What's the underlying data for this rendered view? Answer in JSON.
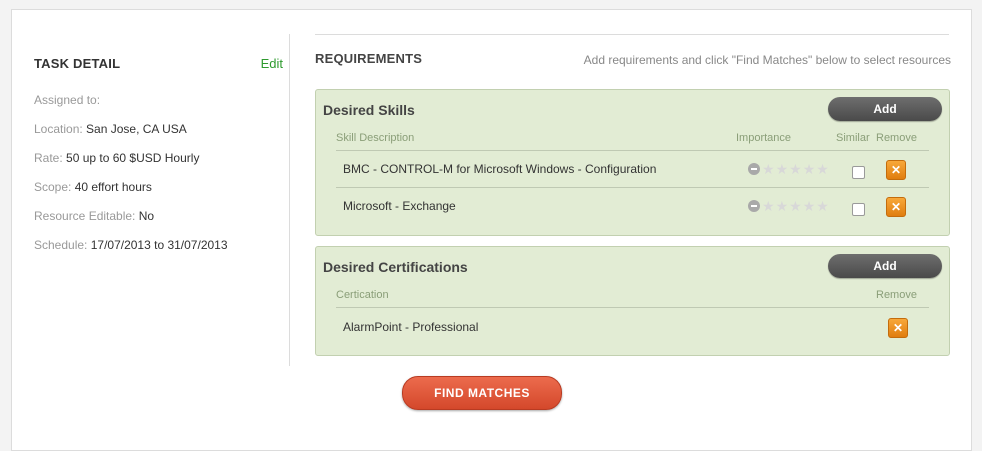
{
  "task_detail": {
    "title": "TASK DETAIL",
    "edit_label": "Edit",
    "assigned_label": "Assigned to:",
    "assigned_value": "",
    "location_label": "Location:",
    "location_value": "San Jose, CA USA",
    "rate_label": "Rate:",
    "rate_value": "50 up to 60 $USD Hourly",
    "scope_label": "Scope:",
    "scope_value": "40 effort hours",
    "editable_label": "Resource Editable:",
    "editable_value": "No",
    "schedule_label": "Schedule:",
    "schedule_value": "17/07/2013 to 31/07/2013"
  },
  "requirements": {
    "title": "REQUIREMENTS",
    "hint": "Add requirements and click \"Find Matches\" below to select resources"
  },
  "skills": {
    "title": "Desired Skills",
    "add_label": "Add",
    "col_description": "Skill Description",
    "col_importance": "Importance",
    "col_similar": "Similar",
    "col_remove": "Remove",
    "rows": [
      {
        "description": "BMC - CONTROL-M for Microsoft Windows - Configuration",
        "importance": 0,
        "similar": false
      },
      {
        "description": "Microsoft - Exchange",
        "importance": 0,
        "similar": false
      }
    ]
  },
  "certifications": {
    "title": "Desired Certifications",
    "add_label": "Add",
    "col_certification": "Certication",
    "col_remove": "Remove",
    "rows": [
      {
        "name": "AlarmPoint - Professional"
      }
    ]
  },
  "find_matches_label": "FIND MATCHES",
  "colors": {
    "accent_green": "#2e9a2e",
    "box_bg": "#e2ecd4",
    "remove_orange": "#f08f1f",
    "find_red": "#e05a3c"
  },
  "icons": [
    "minus-icon",
    "star-icon",
    "remove-icon"
  ]
}
